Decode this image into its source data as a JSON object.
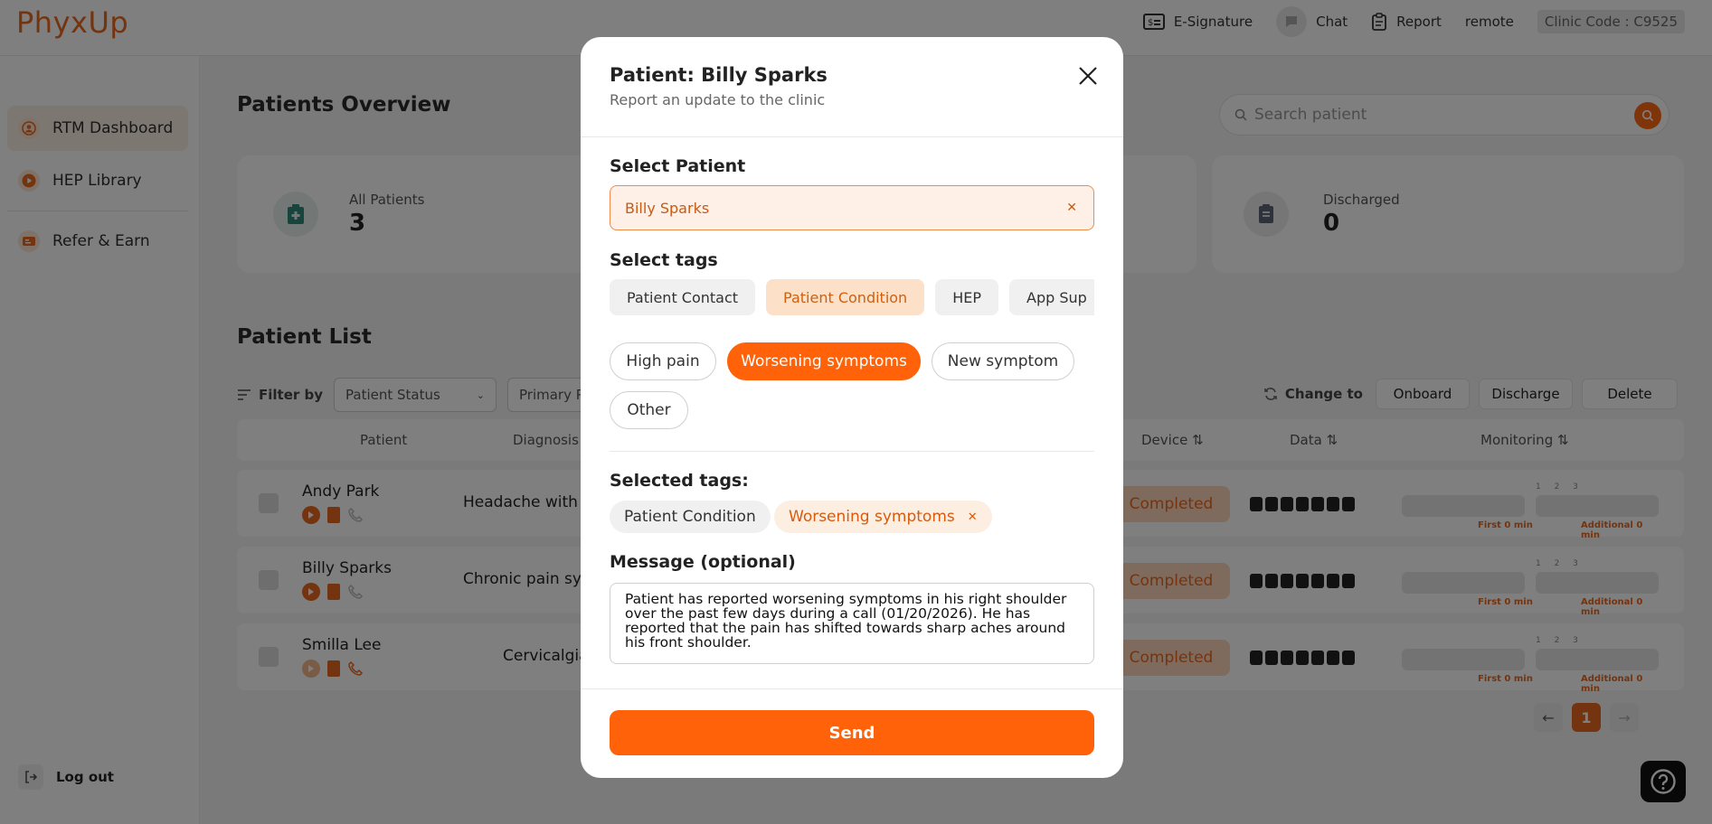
{
  "app": {
    "logo": "PhyxUp"
  },
  "topnav": {
    "esignature": "E-Signature",
    "chat": "Chat",
    "report": "Report",
    "remote": "remote",
    "clinic_code": "Clinic Code : C9525"
  },
  "sidebar": {
    "items": [
      {
        "label": "RTM Dashboard",
        "active": true
      },
      {
        "label": "HEP Library"
      },
      {
        "label": "Refer & Earn"
      }
    ],
    "logout": "Log out"
  },
  "main": {
    "title": "Patients Overview",
    "search_placeholder": "Search patient",
    "stats": [
      {
        "label": "All Patients",
        "value": "3"
      },
      {
        "label": "Discharged",
        "value": "0"
      }
    ],
    "list_title": "Patient List",
    "filter_label": "Filter by",
    "filters": [
      "Patient Status",
      "Primary PT"
    ],
    "change_to": "Change to",
    "actions": [
      "Onboard",
      "Discharge",
      "Delete"
    ],
    "columns": [
      "Patient",
      "Diagnosis",
      "Device",
      "Data",
      "Monitoring"
    ],
    "rows": [
      {
        "name": "Andy Park",
        "diagnosis": "Headache with c",
        "status": "Completed"
      },
      {
        "name": "Billy Sparks",
        "diagnosis": "Chronic pain syn",
        "status": "Completed"
      },
      {
        "name": "Smilla Lee",
        "diagnosis": "Cervicalgia",
        "status": "Completed"
      }
    ],
    "monitoring": {
      "nums": "1 2 3",
      "first": "First 0 min",
      "additional": "Additional 0 min"
    },
    "pagination": {
      "current": "1"
    }
  },
  "modal": {
    "title": "Patient: Billy Sparks",
    "subtitle": "Report an update to the clinic",
    "select_patient_label": "Select Patient",
    "selected_patient": "Billy Sparks",
    "select_tags_label": "Select tags",
    "tag_tabs": [
      "Patient Contact",
      "Patient Condition",
      "HEP",
      "App Sup"
    ],
    "active_tab": "Patient Condition",
    "chips": [
      "High pain",
      "Worsening symptoms",
      "New symptom",
      "Other"
    ],
    "active_chip": "Worsening symptoms",
    "selected_tags_label": "Selected tags:",
    "selected_tags": [
      "Patient Condition",
      "Worsening symptoms"
    ],
    "message_label": "Message (optional)",
    "message_value": "Patient has reported worsening symptoms in his right shoulder over the past few days during a call (01/20/2026). He has reported that the pain has shifted towards sharp aches around his front shoulder.",
    "send": "Send"
  },
  "colors": {
    "accent": "#ff6209",
    "brand": "#e8691e"
  }
}
